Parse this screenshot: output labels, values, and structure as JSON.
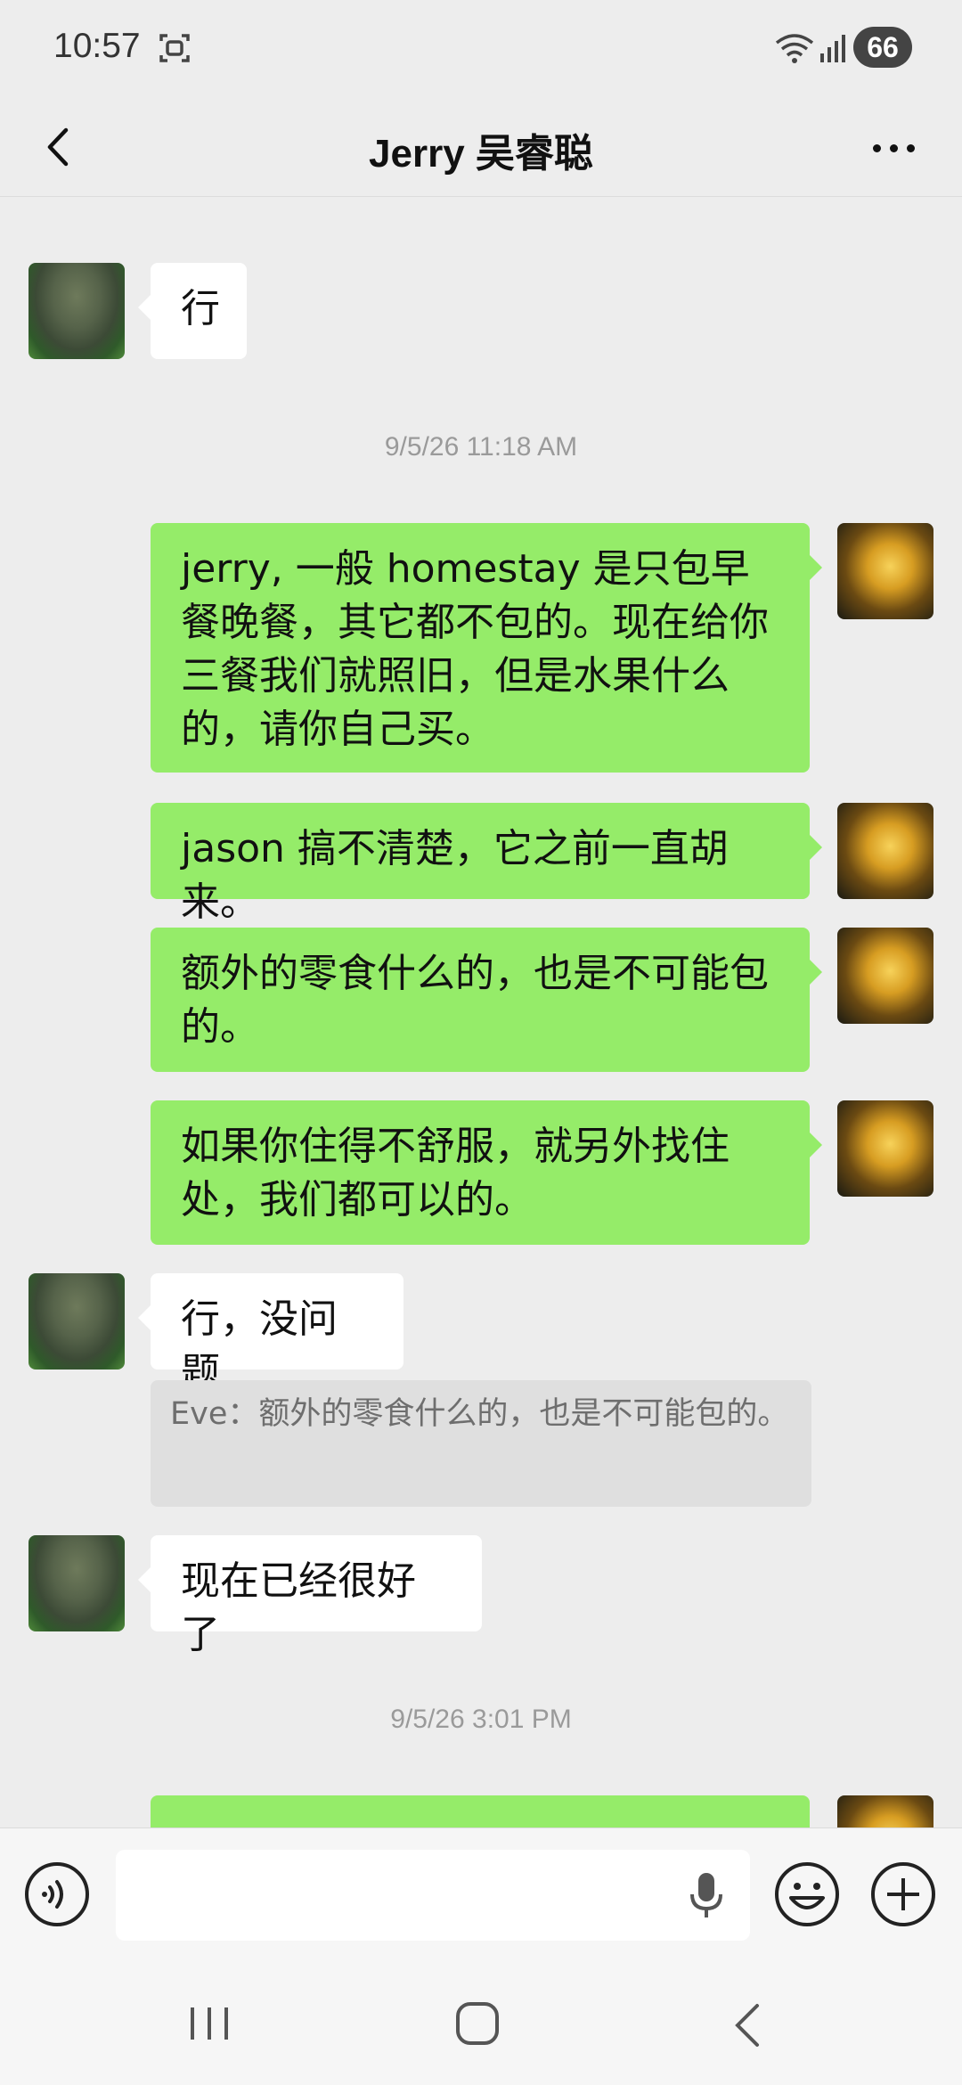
{
  "status_bar": {
    "time": "10:57",
    "battery": "66",
    "icons": [
      "screenshot-icon",
      "wifi-icon",
      "signal-icon"
    ]
  },
  "header": {
    "title": "Jerry 吴睿聪",
    "back_icon": "chevron-left-icon",
    "more_icon": "more-dots-icon"
  },
  "chat": {
    "timestamp_1": "9/5/26 11:18 AM",
    "timestamp_2": "9/5/26 3:01 PM",
    "messages": [
      {
        "sender": "them",
        "text": "行"
      },
      {
        "sender": "me",
        "text": "jerry, 一般 homestay 是只包早餐晚餐，其它都不包的。现在给你三餐我们就照旧，但是水果什么的，请你自己买。"
      },
      {
        "sender": "me",
        "text": "jason 搞不清楚，它之前一直胡来。"
      },
      {
        "sender": "me",
        "text": "额外的零食什么的，也是不可能包的。"
      },
      {
        "sender": "me",
        "text": "如果你住得不舒服，就另外找住处，我们都可以的。"
      },
      {
        "sender": "them",
        "text": "行，没问题"
      },
      {
        "sender": "them",
        "text": "现在已经很好了"
      }
    ],
    "quote": "Eve：额外的零食什么的，也是不可能包的。"
  },
  "input_bar": {
    "placeholder": "",
    "icons": [
      "voice-toggle-icon",
      "mic-icon",
      "emoji-icon",
      "plus-icon"
    ]
  },
  "nav_bar": {
    "icons": [
      "recent-apps-icon",
      "home-icon",
      "back-icon"
    ]
  },
  "colors": {
    "background": "#ededed",
    "outgoing_bubble": "#95ec69",
    "incoming_bubble": "#ffffff"
  }
}
